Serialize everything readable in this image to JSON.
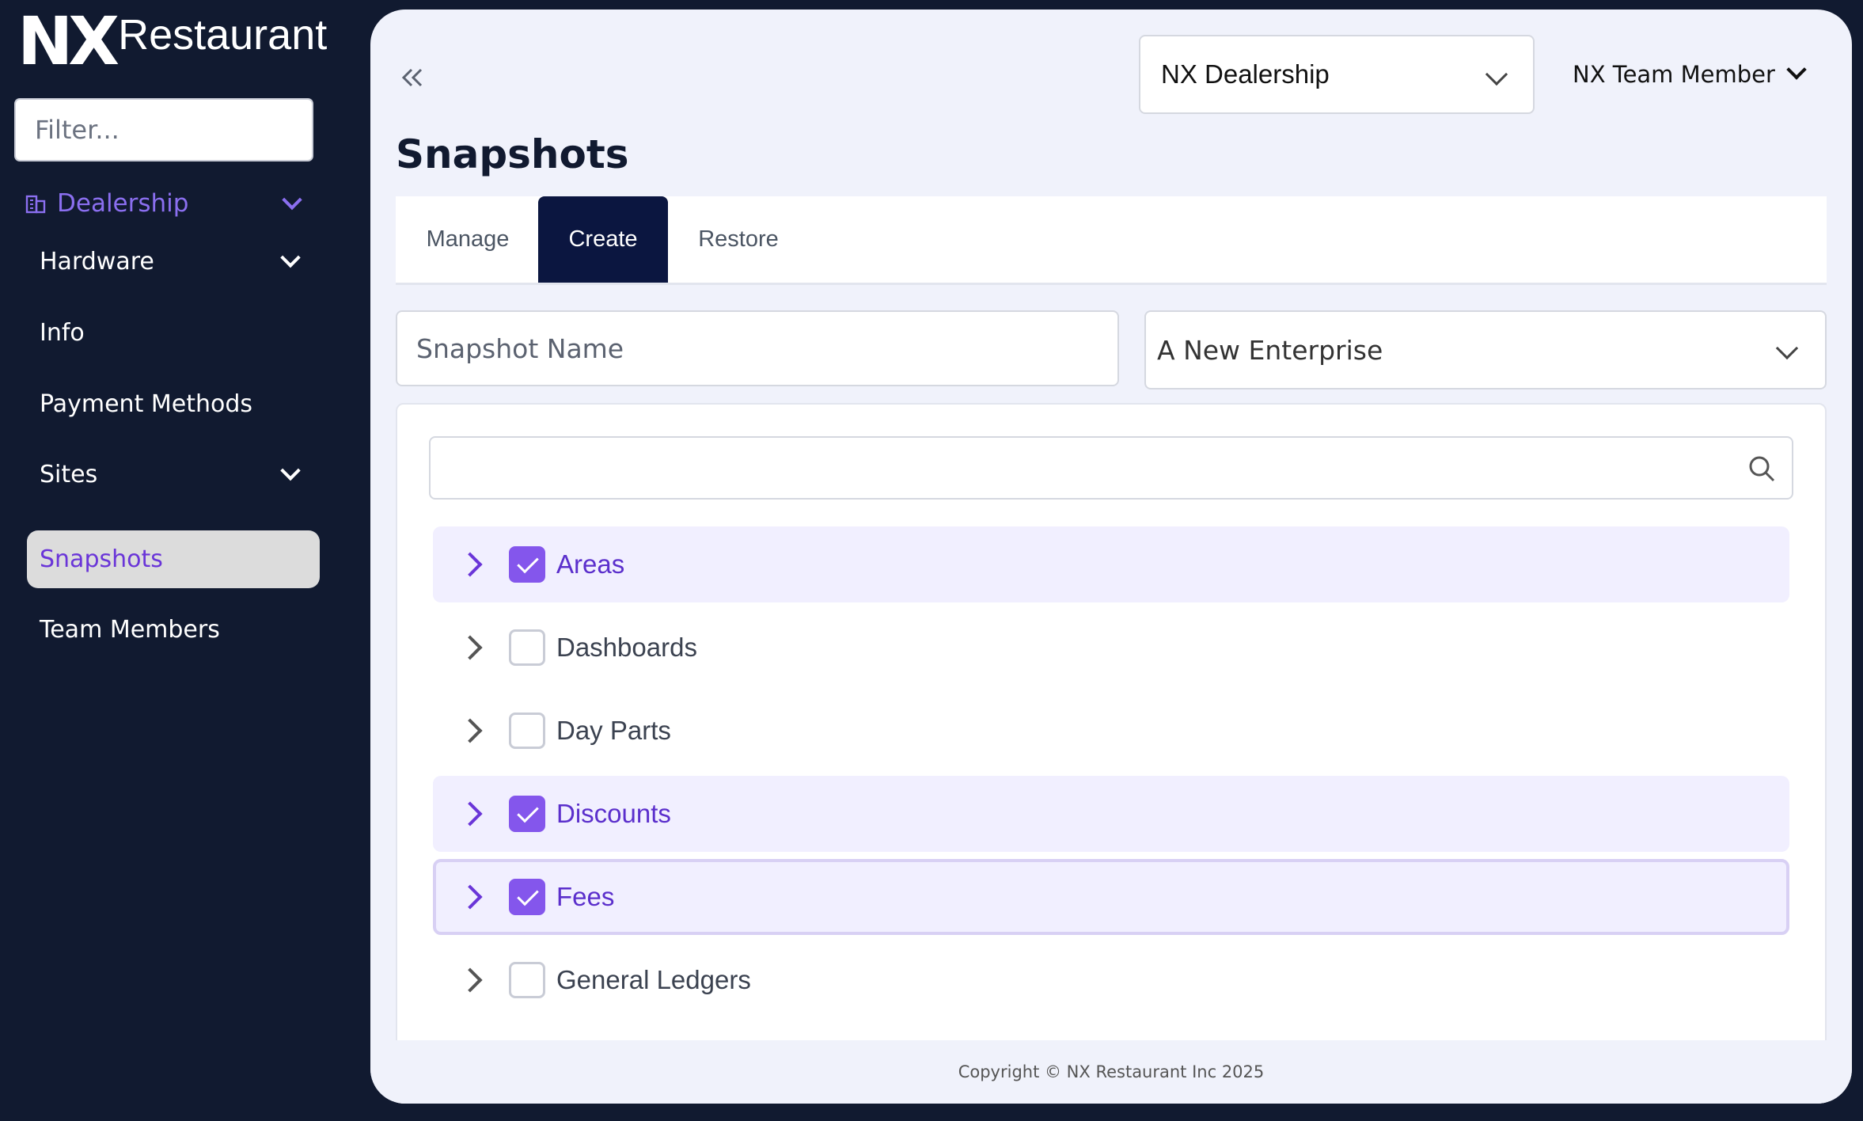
{
  "brand": {
    "mark": "NX",
    "name": "Restaurant"
  },
  "sidebar": {
    "filter_placeholder": "Filter...",
    "group": {
      "label": "Dealership",
      "icon": "building-icon"
    },
    "items": [
      {
        "label": "Hardware",
        "has_children": true
      },
      {
        "label": "Info"
      },
      {
        "label": "Payment Methods"
      },
      {
        "label": "Sites",
        "has_children": true
      },
      {
        "label": "Snapshots",
        "active": true
      },
      {
        "label": "Team Members"
      }
    ]
  },
  "header": {
    "dealership": "NX Dealership",
    "user": "NX Team Member"
  },
  "page": {
    "title": "Snapshots"
  },
  "tabs": [
    {
      "label": "Manage"
    },
    {
      "label": "Create",
      "active": true
    },
    {
      "label": "Restore"
    }
  ],
  "form": {
    "snapshot_name_placeholder": "Snapshot Name",
    "enterprise": "A New Enterprise"
  },
  "tree": {
    "search_value": "",
    "items": [
      {
        "label": "Areas",
        "checked": true
      },
      {
        "label": "Dashboards",
        "checked": false
      },
      {
        "label": "Day Parts",
        "checked": false
      },
      {
        "label": "Discounts",
        "checked": true
      },
      {
        "label": "Fees",
        "checked": true
      },
      {
        "label": "General Ledgers",
        "checked": false
      }
    ]
  },
  "footer": {
    "copyright": "Copyright © NX Restaurant Inc 2025"
  },
  "colors": {
    "sidebar_bg": "#111a30",
    "accent": "#8456ec",
    "tab_active": "#0b1640"
  }
}
